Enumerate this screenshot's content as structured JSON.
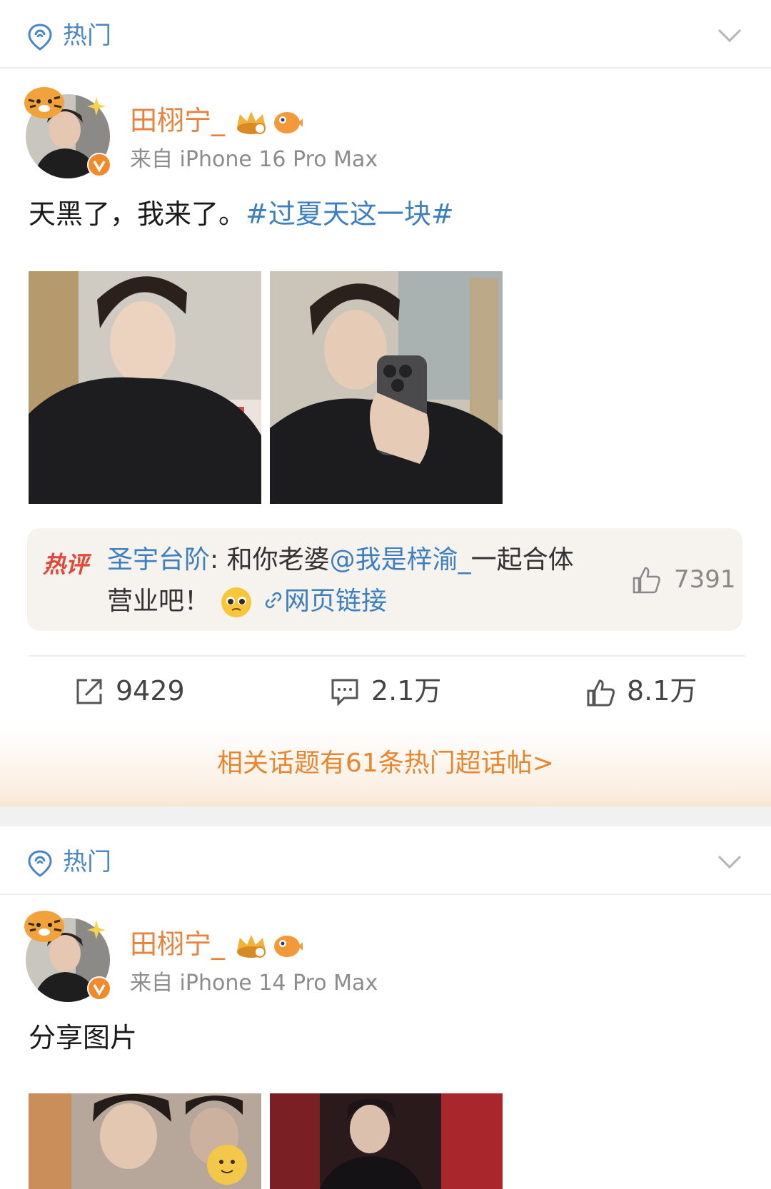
{
  "sections": [
    {
      "header": {
        "label": "热门",
        "icon": "hot-location-icon"
      },
      "post": {
        "username": "田栩宁_",
        "source": "来自 iPhone 16 Pro Max",
        "text": "天黑了，我来了。",
        "topic": "#过夏天这一块#",
        "hot_comment": {
          "tag": "热评",
          "author": "圣宇台阶",
          "separator": ": ",
          "text_before": "和你老婆",
          "mention": "@我是梓渝_",
          "text_after": "一起合体营业吧！",
          "link_label": "网页链接",
          "likes": "7391"
        },
        "actions": {
          "repost": "9429",
          "comments": "2.1万",
          "likes": "8.1万"
        },
        "topic_banner": "相关话题有61条热门超话帖>"
      }
    },
    {
      "header": {
        "label": "热门",
        "icon": "hot-location-icon"
      },
      "post": {
        "username": "田栩宁_",
        "source": "来自 iPhone 14 Pro Max",
        "text": "分享图片"
      }
    }
  ],
  "colors": {
    "accent_blue": "#3e7fbe",
    "username_orange": "#e8823a",
    "hot_red": "#e0463a",
    "banner_orange": "#e8862e"
  }
}
